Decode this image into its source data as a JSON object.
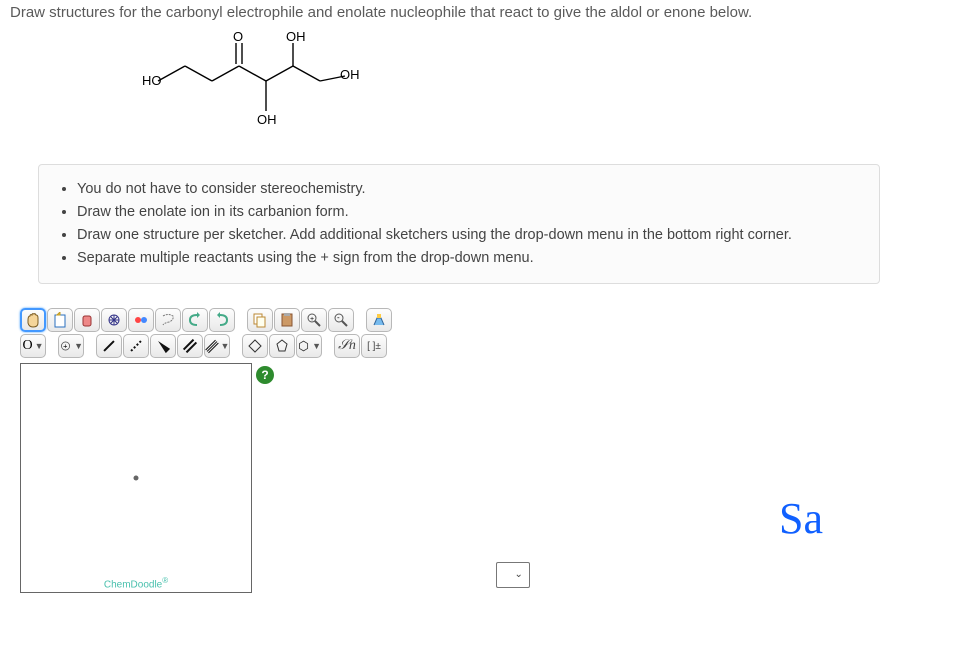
{
  "question": "Draw structures for the carbonyl electrophile and enolate nucleophile that react to give the aldol or enone below.",
  "molecule_labels": {
    "O": "O",
    "OH_top": "OH",
    "HO_left": "HO",
    "OH_right": "OH",
    "OH_bottom": "OH"
  },
  "instructions": [
    "You do not have to consider stereochemistry.",
    "Draw the enolate ion in its carbanion form.",
    "Draw one structure per sketcher. Add additional sketchers using the drop-down menu in the bottom right corner.",
    "Separate multiple reactants using the + sign from the drop-down menu."
  ],
  "toolbar": {
    "row1": {
      "grab": "hand-icon",
      "open": "open-icon",
      "eraser": "eraser-icon",
      "scale": "scale-icon",
      "atoms": "atoms-icon",
      "lasso": "lasso-icon",
      "undo": "undo-icon",
      "redo": "redo-icon",
      "copy": "copy-icon",
      "paste": "paste-icon",
      "zoom_in": "zoom-in-icon",
      "zoom_out": "zoom-out-icon",
      "clean": "clean-icon"
    },
    "row2": {
      "element": "O",
      "plus": "+",
      "bond_single": "/",
      "bond_dotted": "⋯",
      "bond_wedge": "▲",
      "bond_double": "//",
      "bond_dash": "///",
      "shape1": "◯",
      "shape2": "⬠",
      "shape3": "⬡",
      "script": "𝒮n",
      "brackets": "[ ]±"
    }
  },
  "help": "?",
  "branding": "ChemDoodle",
  "annotation": "Sa"
}
